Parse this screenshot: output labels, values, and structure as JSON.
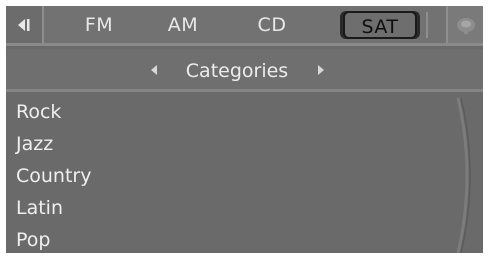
{
  "top_bar": {
    "sources": [
      {
        "label": "FM",
        "selected": false
      },
      {
        "label": "AM",
        "selected": false
      },
      {
        "label": "CD",
        "selected": false
      },
      {
        "label": "SAT",
        "selected": true
      }
    ],
    "back_icon": "back-arrow-icon",
    "menu_icon": "options-icon"
  },
  "category_header": {
    "title": "Categories",
    "prev_icon": "left-arrow-icon",
    "next_icon": "right-arrow-icon"
  },
  "categories": [
    "Rock",
    "Jazz",
    "Country",
    "Latin",
    "Pop"
  ],
  "colors": {
    "screen_background": "#6a6a6a",
    "text": "#efefef",
    "selected_tab_text": "#0f0f0f"
  }
}
